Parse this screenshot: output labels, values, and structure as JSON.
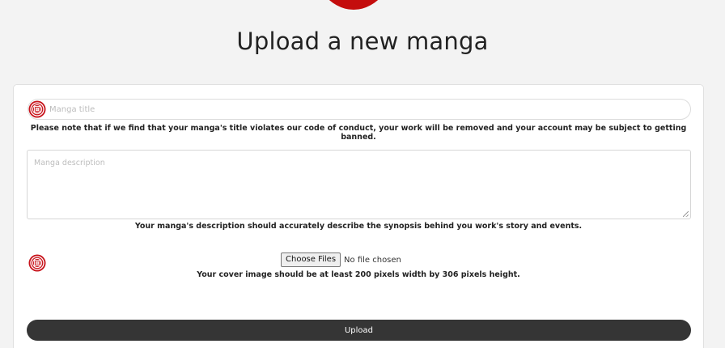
{
  "header": {
    "title": "Upload a new manga"
  },
  "form": {
    "title_input": {
      "placeholder": "Manga title",
      "value": ""
    },
    "title_note": "Please note that if we find that your manga's title violates our code of conduct, your work will be removed and your account may be subject to getting banned.",
    "description_input": {
      "placeholder": "Manga description",
      "value": ""
    },
    "description_note": "Your manga's description should accurately describe the synopsis behind you work's story and events.",
    "cover": {
      "button_label": "Choose Files",
      "status": "No file chosen",
      "note": "Your cover image should be at least 200 pixels width by 306 pixels height."
    },
    "upload_label": "Upload"
  },
  "icons": {
    "logo": "red-circle-logo",
    "field_emblem": "red-seal-emblem-icon"
  },
  "colors": {
    "brand_red": "#c40d0d",
    "page_background": "#f3f3f3",
    "upload_button": "#353535"
  }
}
